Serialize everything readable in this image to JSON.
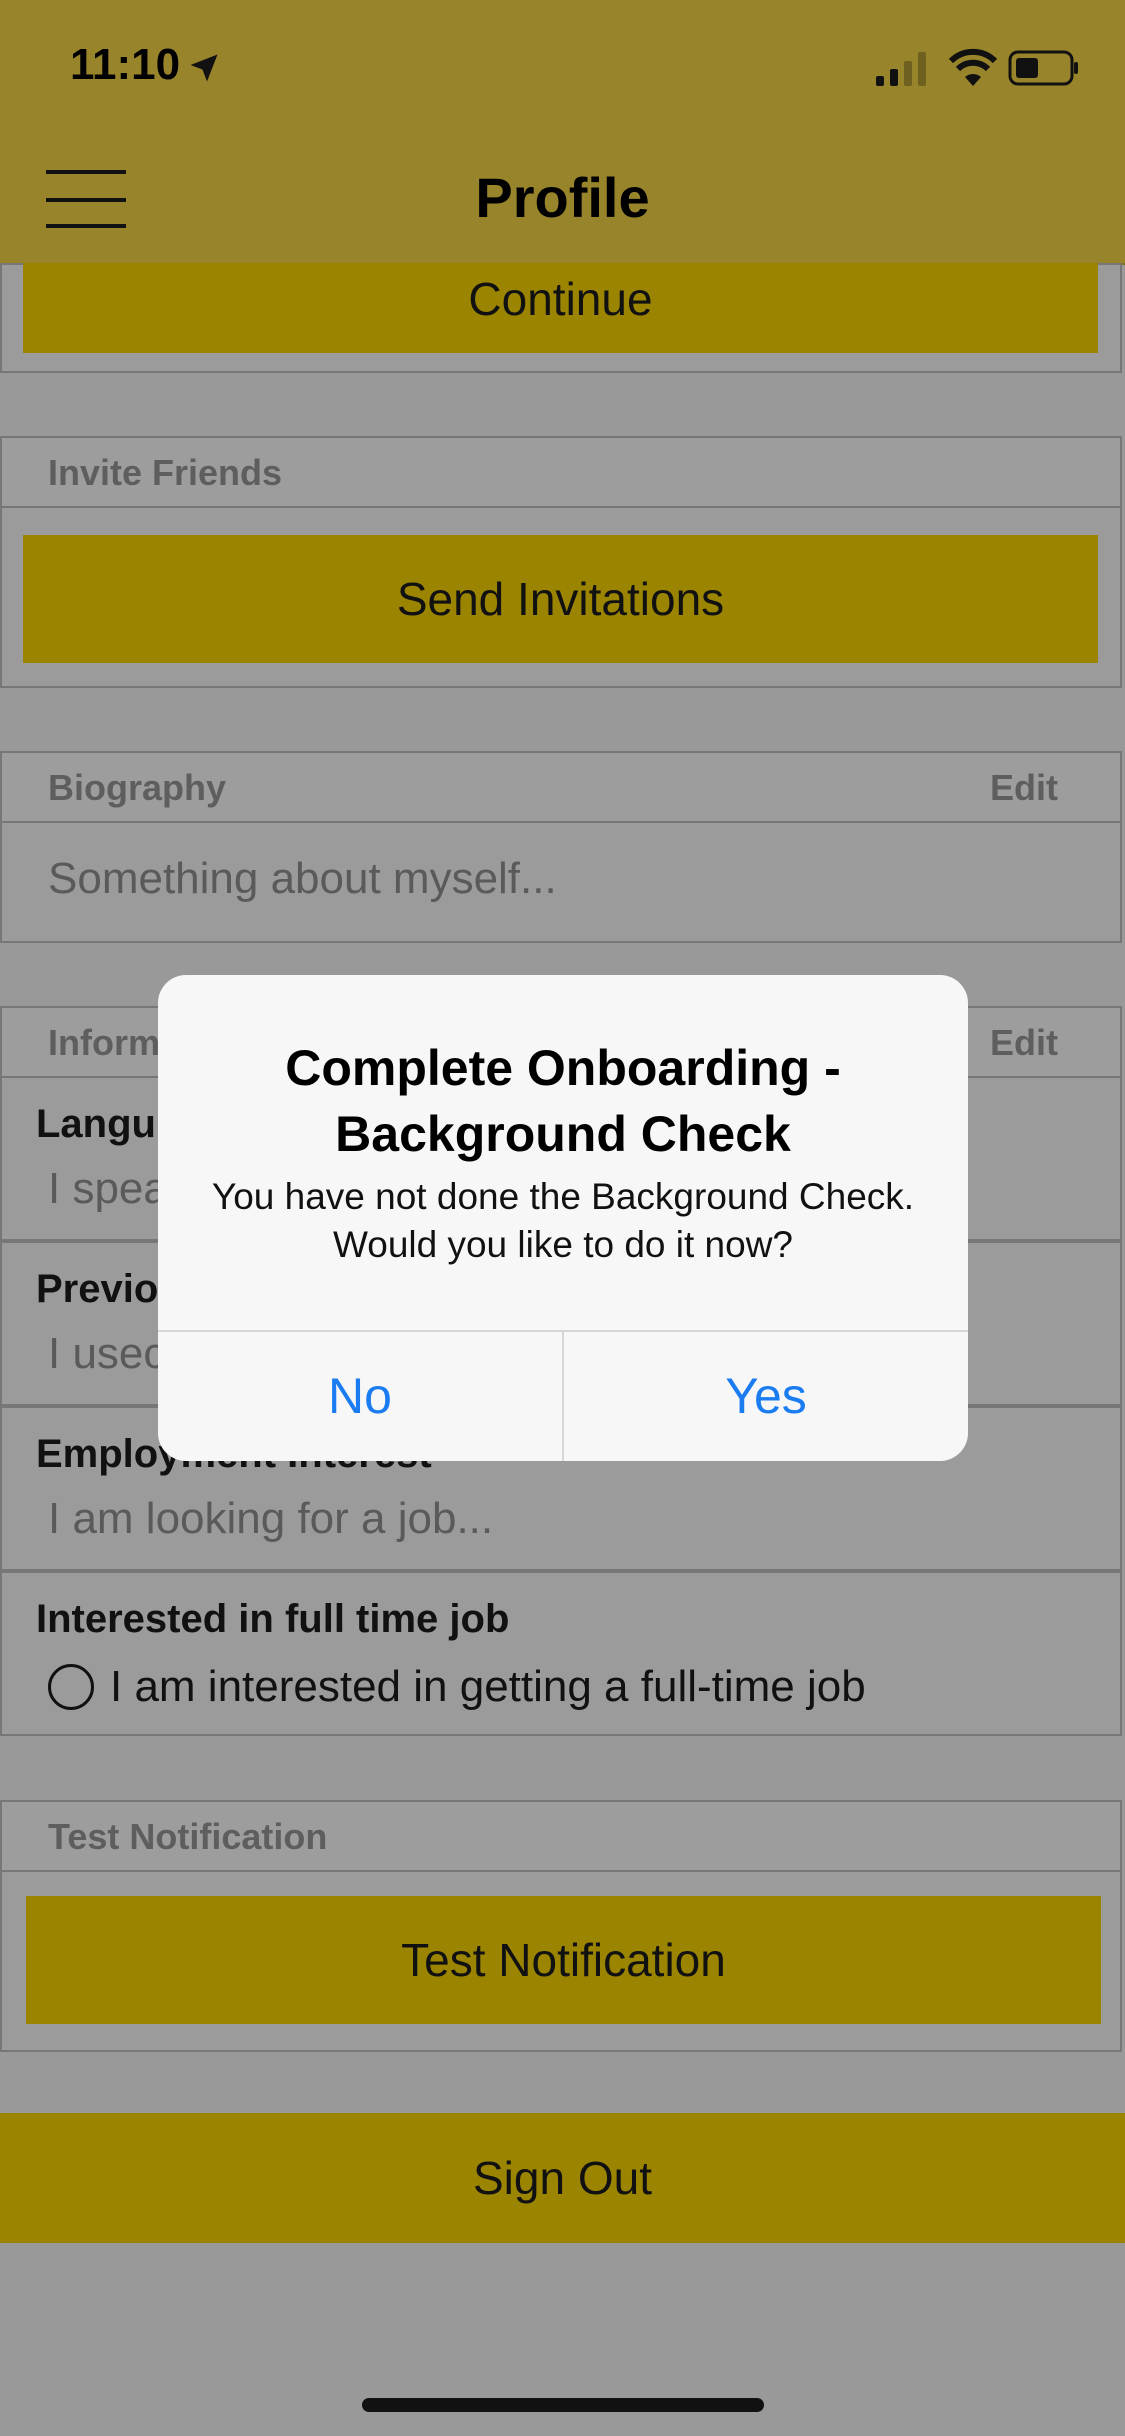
{
  "status_bar": {
    "time": "11:10",
    "location_icon": "location-arrow-icon",
    "signal_icon": "cellular-signal-icon",
    "wifi_icon": "wifi-icon",
    "battery_icon": "battery-icon"
  },
  "nav": {
    "title": "Profile",
    "menu_icon": "hamburger-menu-icon",
    "bar_color": "#98842a"
  },
  "continue_button": "Continue",
  "invite": {
    "label": "Invite Friends",
    "button": "Send Invitations"
  },
  "biography": {
    "label": "Biography",
    "edit": "Edit",
    "placeholder": "Something about myself..."
  },
  "information": {
    "label": "Inform",
    "edit": "Edit",
    "fields": [
      {
        "title": "Langu",
        "value": "I spea"
      },
      {
        "title": "Previo",
        "value": "I usec"
      },
      {
        "title": "Employment Interest",
        "value": "I am looking for a job..."
      }
    ],
    "fulltime": {
      "title": "Interested in full time job",
      "option": "I am interested in getting a full-time job",
      "checked": false
    }
  },
  "test_notification": {
    "label": "Test Notification",
    "button": "Test Notification"
  },
  "sign_out": "Sign Out",
  "accent_color": "#9b8500",
  "dialog": {
    "title": "Complete Onboarding - Background Check",
    "message": "You have not done the Background Check. Would you like to do it now?",
    "no": "No",
    "yes": "Yes",
    "button_color": "#1a7cf0"
  }
}
